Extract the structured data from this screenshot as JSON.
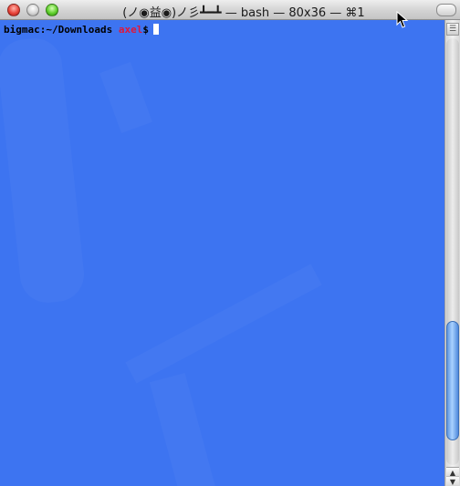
{
  "window": {
    "title": "(ノ◉益◉)ノ彡┻━┻ — bash — 80x36 — ⌘1"
  },
  "terminal": {
    "host_path": "bigmac:~/Downloads ",
    "user": "axel",
    "prompt_symbol": "$"
  },
  "scrollbar": {
    "position": 0.92,
    "visible_fraction": 0.28,
    "split_icon": "split-pane-icon",
    "up_arrow": "▲",
    "down_arrow": "▼"
  },
  "colors": {
    "background": "#3d74f1",
    "user": "#e0183a",
    "text": "#000000",
    "cursor": "#ffffff"
  }
}
